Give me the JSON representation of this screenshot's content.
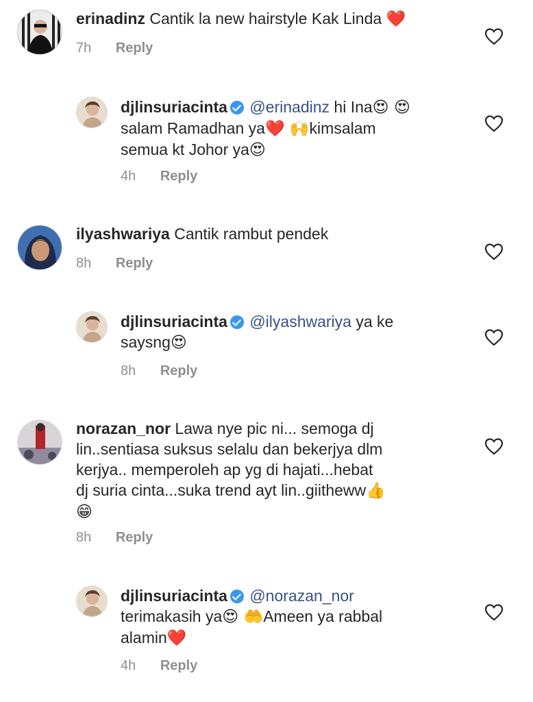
{
  "comments": [
    {
      "username": "erinadinz",
      "text": "Cantik la new hairstyle Kak Linda",
      "emoji": "❤️",
      "time": "7h",
      "reply": "Reply"
    },
    {
      "username": "djlinsuriacinta",
      "mention": "@erinadinz",
      "line1": "hi Ina",
      "line1_emoji": "😍 😍",
      "line2": "salam Ramadhan ya",
      "line2_emoji": "❤️ 🙌",
      "line2b": "kimsalam",
      "line3": "semua kt Johor ya",
      "line3_emoji": "😍",
      "time": "4h",
      "reply": "Reply"
    },
    {
      "username": "ilyashwariya",
      "text": "Cantik rambut pendek",
      "time": "8h",
      "reply": "Reply"
    },
    {
      "username": "djlinsuriacinta",
      "mention": "@ilyashwariya",
      "line1": "ya ke",
      "line2": "saysng",
      "line2_emoji": "😍",
      "time": "8h",
      "reply": "Reply"
    },
    {
      "username": "norazan_nor",
      "line1": "Lawa nye  pic  ni... semoga  dj",
      "line2": "lin..sentiasa  suksus  selalu  dan  bekerjya  dlm",
      "line3": "kerjya.. memperoleh  ap  yg  di hajati...hebat",
      "line4": "dj  suria  cinta...suka trend ayt lin..giitheww",
      "line4_emoji": "👍",
      "line5_emoji": "😁",
      "time": "8h",
      "reply": "Reply"
    },
    {
      "username": "djlinsuriacinta",
      "mention": "@norazan_nor",
      "line1": "terimakasih ya",
      "line1_emoji": "😍 🤲",
      "line1b": "Ameen ya rabbal",
      "line2": "alamin",
      "line2_emoji": "❤️",
      "time": "4h",
      "reply": "Reply"
    }
  ]
}
